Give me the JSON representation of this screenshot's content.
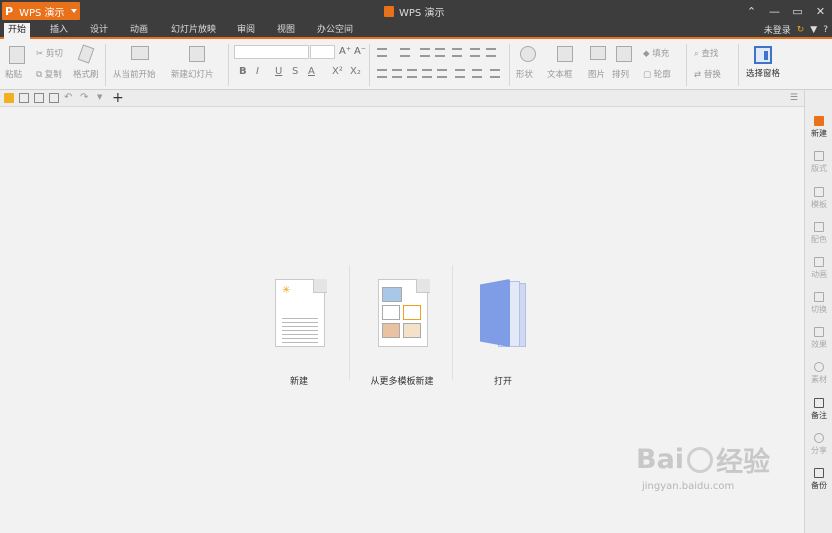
{
  "app": {
    "menu_button_label": "WPS 演示",
    "logo_letter": "P",
    "window_title": "WPS 演示"
  },
  "tabs": [
    {
      "label": "开始",
      "active": true
    },
    {
      "label": "插入"
    },
    {
      "label": "设计"
    },
    {
      "label": "动画"
    },
    {
      "label": "幻灯片放映"
    },
    {
      "label": "审阅"
    },
    {
      "label": "视图"
    },
    {
      "label": "办公空间"
    }
  ],
  "account": {
    "login_label": "未登录",
    "help_label": "?"
  },
  "ribbon": {
    "paste": "粘贴",
    "cut": "剪切",
    "copy": "复制",
    "format_painter": "格式刷",
    "from_current": "从当前开始",
    "new_slide": "新建幻灯片",
    "shape": "形状",
    "textbox": "文本框",
    "picture": "图片",
    "arrange": "排列",
    "fill": "填充",
    "outline": "轮廓",
    "find": "查找",
    "replace": "替换",
    "selection_pane": "选择窗格",
    "bold": "B",
    "italic": "I",
    "underline": "U",
    "strike": "S",
    "font_color": "A",
    "superscript": "X²",
    "subscript": "X₂",
    "grow_font": "A⁺",
    "shrink_font": "A⁻"
  },
  "start": {
    "new_label": "新建",
    "from_template_label": "从更多模板新建",
    "open_label": "打开"
  },
  "sidebar": [
    {
      "label": "新建",
      "enabled": true
    },
    {
      "label": "版式"
    },
    {
      "label": "模板"
    },
    {
      "label": "配色"
    },
    {
      "label": "动画"
    },
    {
      "label": "切换"
    },
    {
      "label": "效果"
    },
    {
      "label": "素材"
    },
    {
      "label": "备注",
      "enabled": true
    },
    {
      "label": "分享"
    },
    {
      "label": "备份",
      "enabled": true
    }
  ],
  "watermark": {
    "brand_left": "Bai",
    "brand_right": "经验",
    "url": "jingyan.baidu.com"
  },
  "colors": {
    "accent": "#e8711a",
    "titlebar": "#3d3d3d",
    "folder": "#7f9ce6"
  }
}
